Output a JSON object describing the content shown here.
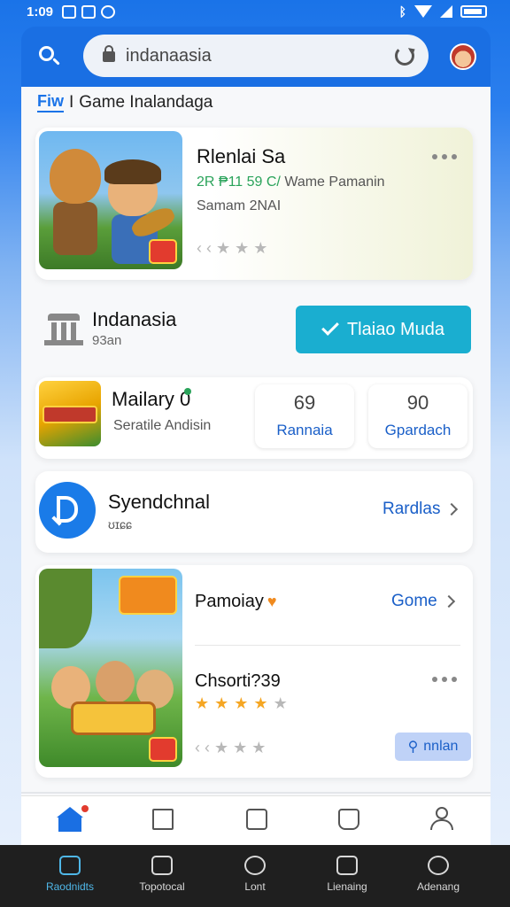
{
  "status_bar": {
    "time": "1:09",
    "icons": [
      "notification-icon",
      "notification-icon",
      "bluetooth-icon",
      "wifi-icon",
      "signal-icon",
      "battery-icon"
    ]
  },
  "browser": {
    "url": "indanaasia",
    "icons": [
      "search-icon",
      "lock-icon",
      "reload-icon",
      "avatar"
    ]
  },
  "breadcrumb": {
    "logo": "Fiw",
    "separator": "I",
    "title": "Game Inalandaga"
  },
  "featured": {
    "title": "Rlenlai Sa",
    "line1_prefix": "2R ₱11 59 C/",
    "line1_suffix": " Wame Pamanin",
    "line2": "Samam 2NAI",
    "rating": "‹ ‹ ★ ★ ★"
  },
  "publisher_row": {
    "title": "Indanasia",
    "subtitle": "93an",
    "cta_label": "Tlaiao Muda"
  },
  "stats_card": {
    "title": "Mailary 0",
    "subtitle": "Seratile Andisin",
    "stats": [
      {
        "value": "69",
        "label": "Rannaia"
      },
      {
        "value": "90",
        "label": "Gpardach"
      }
    ]
  },
  "sync_card": {
    "title": "Syendchnal",
    "subtitle": "ʊɪɕɕ",
    "link": "Rardlas"
  },
  "game_card": {
    "header": "Pamoiay",
    "header_link": "Gome",
    "title": "Chsorti?39",
    "stars_filled": 4,
    "stars_total": 5,
    "rating": "‹ ‹ ★ ★ ★",
    "install_label": "nnlan"
  },
  "app_tabs": [
    "home-icon",
    "edit-icon",
    "library-icon",
    "bag-icon",
    "profile-icon"
  ],
  "system_nav": [
    {
      "label": "Raodnidts",
      "icon": "home-icon",
      "active": true
    },
    {
      "label": "Topotocal",
      "icon": "store-icon",
      "active": false
    },
    {
      "label": "Lont",
      "icon": "compass-icon",
      "active": false
    },
    {
      "label": "Lienaing",
      "icon": "inbox-icon",
      "active": false
    },
    {
      "label": "Adenang",
      "icon": "account-icon",
      "active": false
    }
  ],
  "colors": {
    "accent": "#1a6fe3",
    "cta": "#1aaed0",
    "star": "#f5a623",
    "nav_active": "#4fb7e8"
  }
}
